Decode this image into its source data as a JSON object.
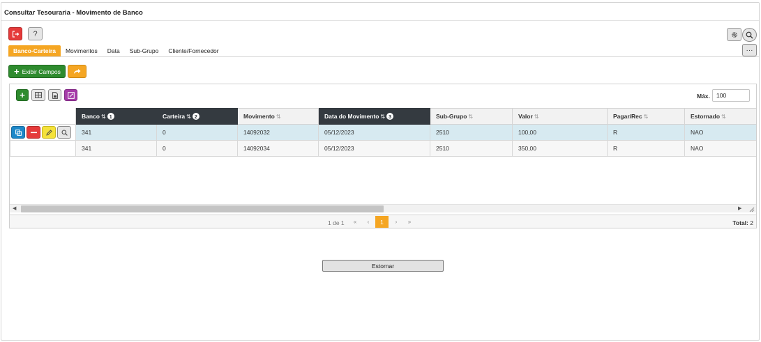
{
  "window": {
    "title": "Consultar Tesouraria - Movimento de Banco"
  },
  "colors": {
    "accent": "#f5a623",
    "danger": "#e53a3a",
    "success": "#2e8b2e",
    "info": "#1e88c8",
    "purple": "#a53aa8",
    "header_dark": "#343a40",
    "selected_row": "#d7eaf1"
  },
  "toolbar": {
    "exit_icon": "exit-icon",
    "help_label": "?",
    "settings_icon": "gear-icon",
    "search_icon": "search-icon",
    "more_label": "···"
  },
  "tabs": [
    {
      "label": "Banco-Carteira",
      "active": true
    },
    {
      "label": "Movimentos",
      "active": false
    },
    {
      "label": "Data",
      "active": false
    },
    {
      "label": "Sub-Grupo",
      "active": false
    },
    {
      "label": "Cliente/Fornecedor",
      "active": false
    }
  ],
  "actions": {
    "exibir_campos_label": "Exibir Campos",
    "share_icon": "share-arrow-icon"
  },
  "grid": {
    "tools": [
      "add-icon",
      "columns-icon",
      "export-icon",
      "clear-filter-icon"
    ],
    "max_label": "Máx.",
    "max_value": "100",
    "columns": [
      {
        "label": "Banco",
        "sort_icon": "⇅",
        "order": "1",
        "sorted": true
      },
      {
        "label": "Carteira",
        "sort_icon": "⇅",
        "order": "2",
        "sorted": true
      },
      {
        "label": "Movimento",
        "sort_icon": "⇅",
        "order": "",
        "sorted": false
      },
      {
        "label": "Data do Movimento",
        "sort_icon": "⇅",
        "order": "3",
        "sorted": true
      },
      {
        "label": "Sub-Grupo",
        "sort_icon": "⇅",
        "order": "",
        "sorted": false
      },
      {
        "label": "Valor",
        "sort_icon": "⇅",
        "order": "",
        "sorted": false
      },
      {
        "label": "Pagar/Rec",
        "sort_icon": "⇅",
        "order": "",
        "sorted": false
      },
      {
        "label": "Estornado",
        "sort_icon": "⇅",
        "order": "",
        "sorted": false
      }
    ],
    "rows": [
      {
        "cells": [
          "341",
          "0",
          "14092032",
          "05/12/2023",
          "2510",
          "100,00",
          "R",
          "NAO"
        ],
        "selected": true
      },
      {
        "cells": [
          "341",
          "0",
          "14092034",
          "05/12/2023",
          "2510",
          "350,00",
          "R",
          "NAO"
        ],
        "selected": false
      }
    ],
    "row_actions": [
      "copy-icon",
      "delete-icon",
      "edit-icon",
      "view-icon"
    ],
    "pager": {
      "info": "1 de 1",
      "first": "«",
      "prev": "‹",
      "current": "1",
      "next": "›",
      "last": "»",
      "total_label": "Total:",
      "total_value": "2"
    }
  },
  "footer": {
    "estornar_label": "Estornar"
  }
}
